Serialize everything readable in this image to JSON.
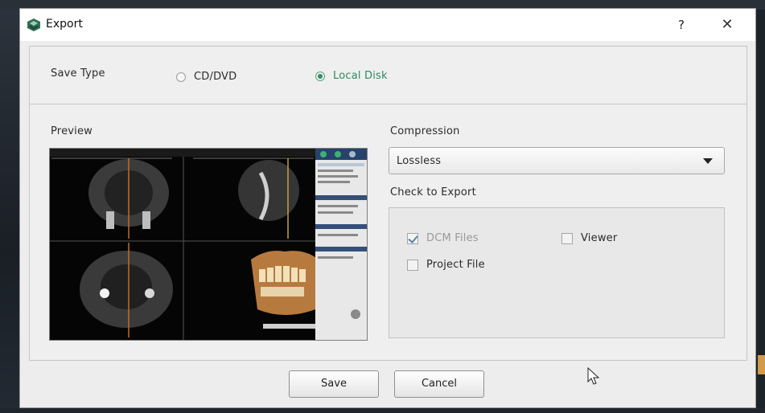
{
  "dialog": {
    "title": "Export",
    "help_label": "?",
    "close_label": "✕"
  },
  "save_type": {
    "label": "Save Type",
    "options": [
      {
        "label": "CD/DVD",
        "selected": false
      },
      {
        "label": "Local Disk",
        "selected": true
      }
    ]
  },
  "preview": {
    "label": "Preview"
  },
  "compression": {
    "label": "Compression",
    "selected": "Lossless"
  },
  "export": {
    "label": "Check to Export",
    "items": [
      {
        "label": "DCM Files",
        "checked": true,
        "enabled": false
      },
      {
        "label": "Viewer",
        "checked": false,
        "enabled": true
      },
      {
        "label": "Project File",
        "checked": false,
        "enabled": true
      }
    ]
  },
  "buttons": {
    "save": "Save",
    "cancel": "Cancel"
  },
  "colors": {
    "accent_green": "#2d8a5f",
    "checkmark_blue": "#5d86a8"
  }
}
